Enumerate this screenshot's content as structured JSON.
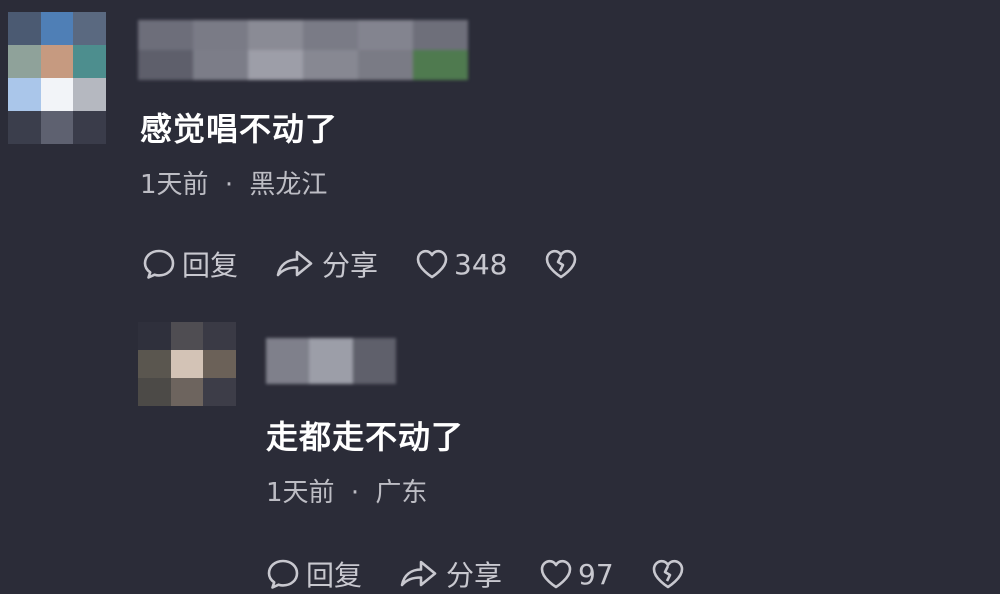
{
  "comments": [
    {
      "text": "感觉唱不动了",
      "time": "1天前",
      "separator": "·",
      "location": "黑龙江",
      "reply_label": "回复",
      "share_label": "分享",
      "likes": "348",
      "avatar_colors": [
        "#4b5a72",
        "#4f7fb6",
        "#5a6980",
        "#8fa29a",
        "#c69a80",
        "#4d8e8e",
        "#aac6ea",
        "#f2f4f8",
        "#b5b8c0",
        "#3b3e4c",
        "#5e6170",
        "#3a3c4a"
      ],
      "name_colors": [
        "#6d6e7a",
        "#7a7b86",
        "#8a8b95",
        "#7a7b86",
        "#83848f",
        "#6e6f7a",
        "#5e5f6b",
        "#7c7d88",
        "#9d9ea8",
        "#878892",
        "#7a7b85",
        "#4f7a4f"
      ]
    },
    {
      "text": "走都走不动了",
      "time": "1天前",
      "separator": "·",
      "location": "广东",
      "reply_label": "回复",
      "share_label": "分享",
      "likes": "97",
      "avatar_colors": [
        "#2f303c",
        "#4f4d52",
        "#3a3a45",
        "#5a564f",
        "#d3c3b6",
        "#6b6158",
        "#4c4a47",
        "#6d645e",
        "#3d3d48"
      ],
      "name_colors": [
        "#7f808b",
        "#9c9ea8",
        "#5f606b"
      ]
    }
  ],
  "colors": {
    "background": "#2b2c38",
    "text": "#ffffff",
    "meta": "#bdbdc4",
    "icon": "#c8c8cf"
  },
  "icons": {
    "reply": "speech-bubble-icon",
    "share": "share-arrow-icon",
    "like": "heart-icon",
    "dislike": "broken-heart-icon"
  }
}
